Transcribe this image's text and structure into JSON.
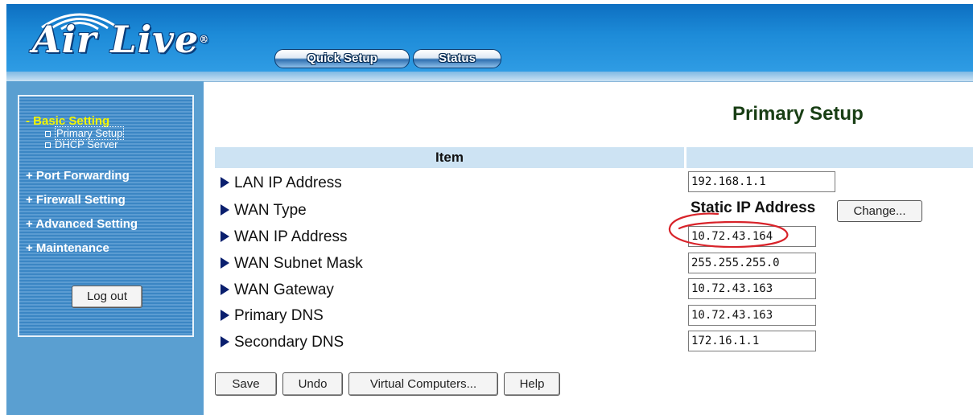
{
  "header": {
    "brand": "Air Live",
    "brand_mark": "®",
    "tabs": [
      {
        "label": "Quick Setup"
      },
      {
        "label": "Status"
      }
    ]
  },
  "sidebar": {
    "basic_setting": "- Basic Setting",
    "sub_items": [
      "Primary Setup",
      "DHCP Server"
    ],
    "items": [
      "+ Port Forwarding",
      "+ Firewall Setting",
      "+ Advanced Setting",
      "+ Maintenance"
    ],
    "logout_label": "Log out"
  },
  "main": {
    "title": "Primary Setup",
    "table_header": "Item",
    "rows": [
      {
        "label": "LAN IP Address",
        "value": "192.168.1.1"
      },
      {
        "label": "WAN Type",
        "value": "Static IP Address",
        "button": "Change..."
      },
      {
        "label": "WAN IP Address",
        "value": "10.72.43.164"
      },
      {
        "label": "WAN Subnet Mask",
        "value": "255.255.255.0"
      },
      {
        "label": "WAN Gateway",
        "value": "10.72.43.163"
      },
      {
        "label": "Primary DNS",
        "value": "10.72.43.163"
      },
      {
        "label": "Secondary DNS",
        "value": "172.16.1.1"
      }
    ],
    "buttons": {
      "save": "Save",
      "undo": "Undo",
      "virtual_computers": "Virtual Computers...",
      "help": "Help"
    }
  },
  "colors": {
    "header_blue": "#1d8bd8",
    "sidebar_blue": "#3b86c4",
    "active_menu_yellow": "#f3f500",
    "title_green": "#183e14",
    "annotation_red": "#d8232a"
  }
}
